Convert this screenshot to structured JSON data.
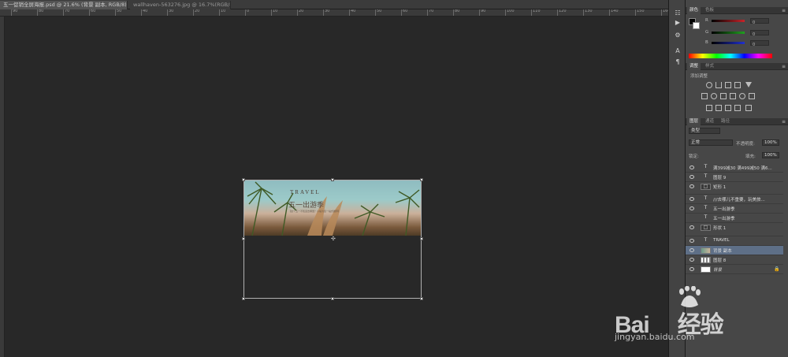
{
  "tabs": [
    {
      "label": "五一促销全屏海报.psd @ 21.6% (背景 副本, RGB/8) *",
      "close": "×",
      "active": true
    },
    {
      "label": "wallhaven-563276.jpg @ 16.7%(RGB/8)",
      "close": "×",
      "active": false
    }
  ],
  "ruler": {
    "marks": [
      "90",
      "80",
      "70",
      "60",
      "50",
      "40",
      "30",
      "20",
      "10",
      "0",
      "10",
      "20",
      "30",
      "40",
      "50",
      "60",
      "70",
      "80",
      "90",
      "100",
      "110",
      "120",
      "130",
      "140",
      "150",
      "160"
    ]
  },
  "canvas_image": {
    "title": "TRAVEL",
    "headline": "五一出游季",
    "tagline": "【这个五一不知道去哪里？小编为您一站式推荐】"
  },
  "color_panel": {
    "tabs": [
      "颜色",
      "色板"
    ],
    "sliders": [
      {
        "label": "R",
        "color": "#c8242a"
      },
      {
        "label": "G",
        "color": "#20a020"
      },
      {
        "label": "B",
        "color": "#2030d0"
      }
    ],
    "values": [
      "0",
      "0",
      "0"
    ],
    "foreground": "#000000",
    "background": "#ffffff"
  },
  "adjustments_panel": {
    "tabs": [
      "调整",
      "样式"
    ],
    "hint": "添加调整"
  },
  "layers_panel": {
    "tabs": [
      "图层",
      "通道",
      "路径"
    ],
    "filter_label": "类型",
    "blend_mode": "正常",
    "opacity_label": "不透明度:",
    "opacity_value": "100%",
    "lock_label": "锁定:",
    "fill_label": "填充:",
    "fill_value": "100%",
    "layers": [
      {
        "name": "满399减30 满499减50 满6...",
        "type": "T",
        "visible": true
      },
      {
        "name": "图层 9",
        "type": "T",
        "visible": true
      },
      {
        "name": "矩形 1",
        "type": "shape",
        "visible": true
      },
      {
        "name": "///去哪儿不重要，玩美旅...",
        "type": "T",
        "visible": true
      },
      {
        "name": "五一出游季",
        "type": "T",
        "visible": true
      },
      {
        "name": "五一出游季",
        "type": "T",
        "visible": false
      },
      {
        "name": "形状 1",
        "type": "shape",
        "visible": true
      },
      {
        "name": "TRAVEL",
        "type": "T",
        "visible": true
      },
      {
        "name": "背景 副本",
        "type": "image",
        "visible": true,
        "selected": true
      },
      {
        "name": "图层 8",
        "type": "pattern",
        "visible": true
      },
      {
        "name": "背景",
        "type": "white",
        "visible": true,
        "locked": true
      }
    ]
  },
  "watermark": {
    "brand": "Bai",
    "brand_suffix": "经验",
    "url": "jingyan.baidu.com"
  }
}
